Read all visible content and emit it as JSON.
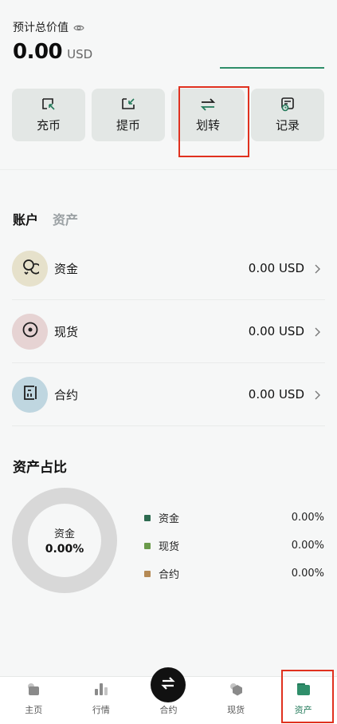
{
  "header": {
    "total_label": "预计总价值",
    "total_value": "0.00",
    "currency": "USD"
  },
  "actions": [
    {
      "label": "充币",
      "icon": "deposit-icon"
    },
    {
      "label": "提币",
      "icon": "withdraw-icon"
    },
    {
      "label": "划转",
      "icon": "transfer-icon"
    },
    {
      "label": "记录",
      "icon": "record-icon"
    }
  ],
  "tabs": {
    "account": "账户",
    "assets": "资产"
  },
  "accounts": [
    {
      "name": "资金",
      "value": "0.00 USD",
      "icon": "funding-icon",
      "color": "#e6e1cb"
    },
    {
      "name": "现货",
      "value": "0.00 USD",
      "icon": "spot-icon",
      "color": "#e6d3d3"
    },
    {
      "name": "合约",
      "value": "0.00 USD",
      "icon": "futures-icon",
      "color": "#bfd6e0"
    }
  ],
  "allocation": {
    "title": "资产占比",
    "center_label": "资金",
    "center_value": "0.00%",
    "legend": [
      {
        "name": "资金",
        "pct": "0.00%",
        "color": "#2e6b50"
      },
      {
        "name": "现货",
        "pct": "0.00%",
        "color": "#6a9a4a"
      },
      {
        "name": "合约",
        "pct": "0.00%",
        "color": "#b58a55"
      }
    ]
  },
  "nav": [
    {
      "label": "主页",
      "icon": "home-icon"
    },
    {
      "label": "行情",
      "icon": "market-icon"
    },
    {
      "label": "合约",
      "icon": "futures-nav-icon"
    },
    {
      "label": "现货",
      "icon": "spot-nav-icon"
    },
    {
      "label": "资产",
      "icon": "assets-icon"
    }
  ],
  "accent_color": "#237a5a"
}
